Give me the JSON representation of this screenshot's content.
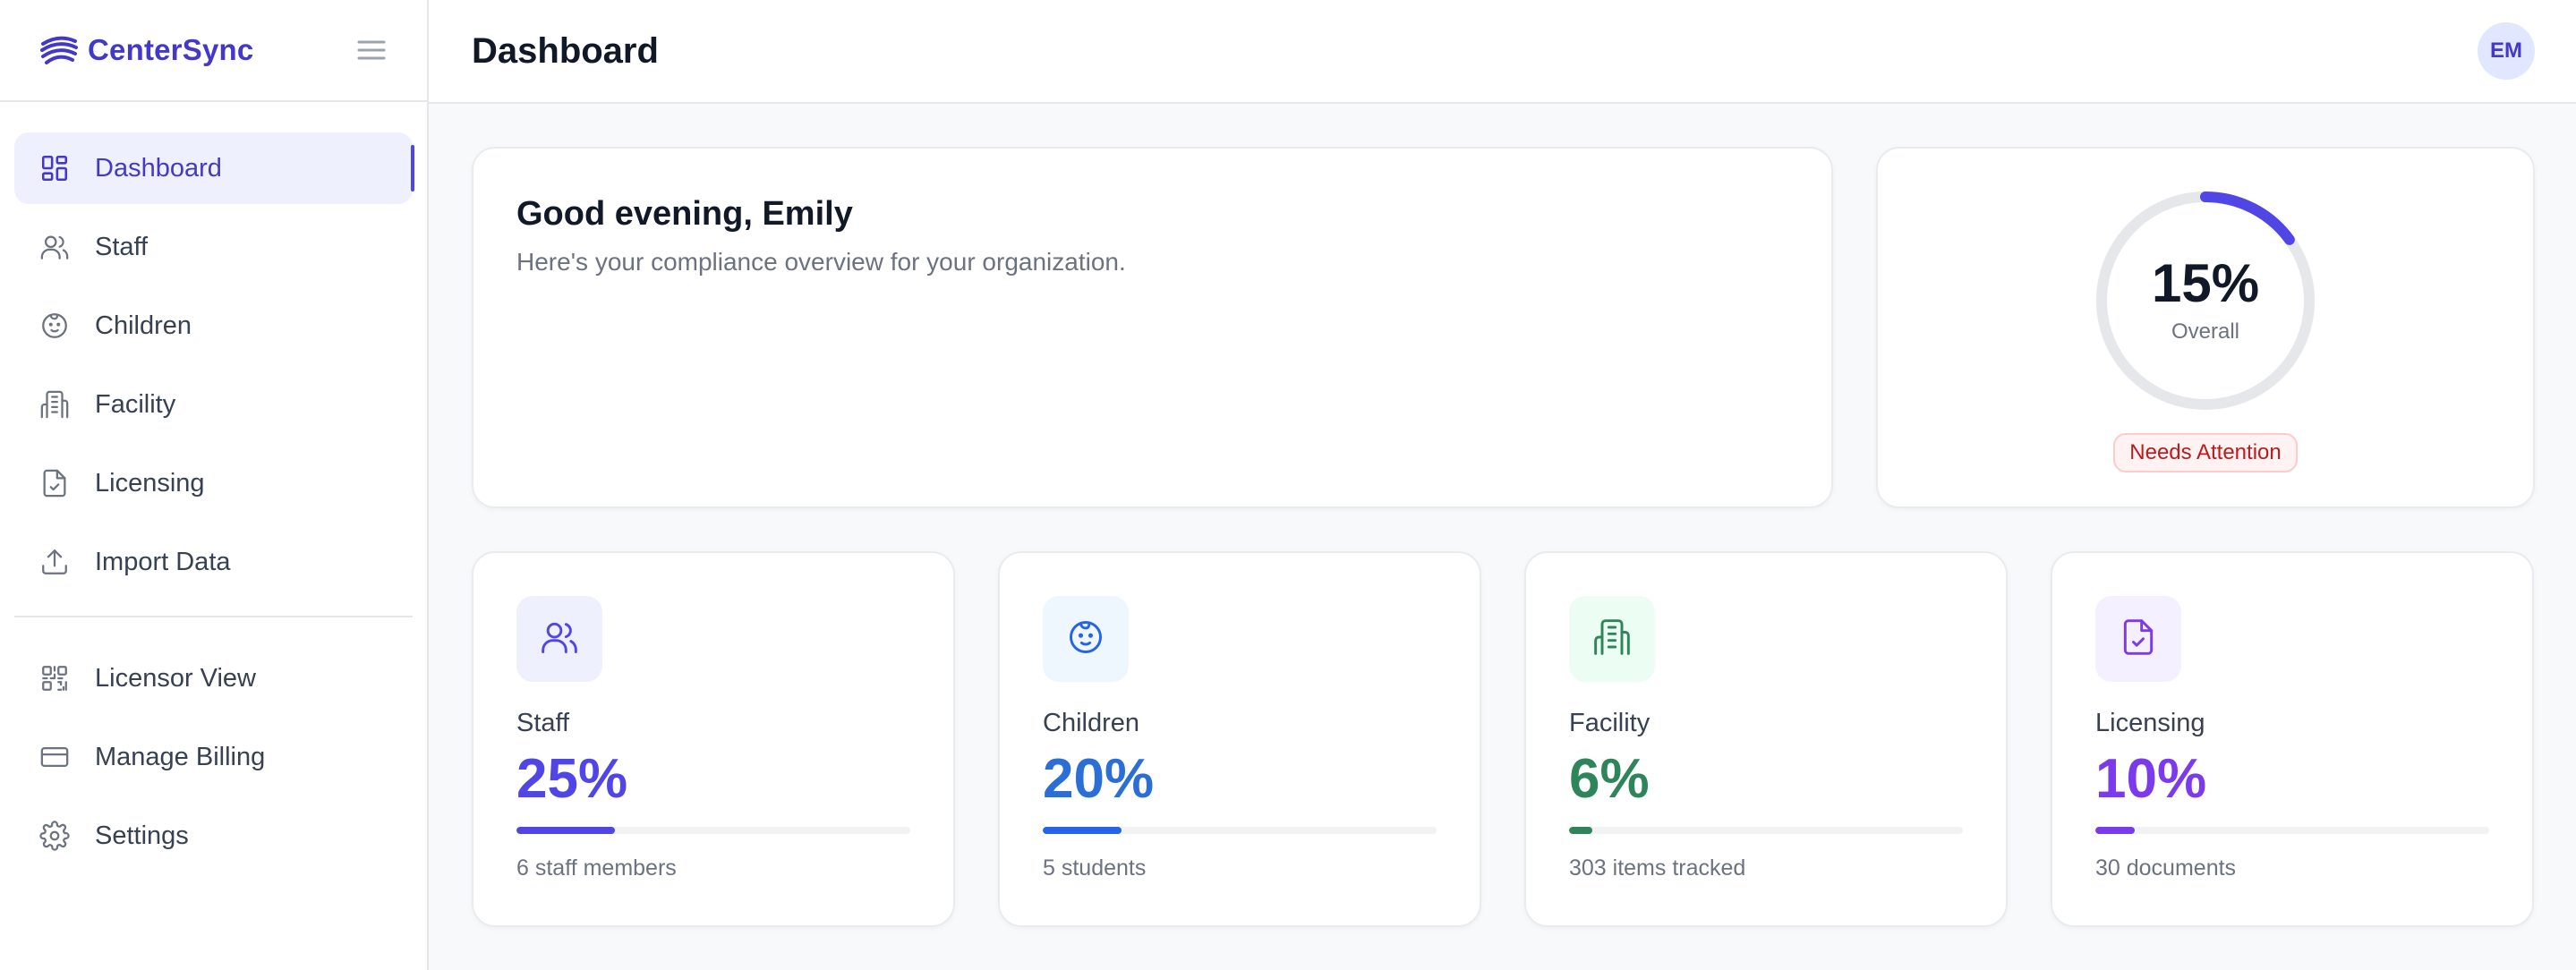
{
  "app": {
    "name": "CenterSync"
  },
  "header": {
    "title": "Dashboard",
    "avatar_initials": "EM"
  },
  "sidebar": {
    "items": [
      {
        "label": "Dashboard",
        "icon": "dashboard-grid-icon",
        "active": true
      },
      {
        "label": "Staff",
        "icon": "users-icon"
      },
      {
        "label": "Children",
        "icon": "baby-face-icon"
      },
      {
        "label": "Facility",
        "icon": "building-icon"
      },
      {
        "label": "Licensing",
        "icon": "file-check-icon"
      },
      {
        "label": "Import Data",
        "icon": "upload-icon"
      }
    ],
    "secondary_items": [
      {
        "label": "Licensor View",
        "icon": "qr-code-icon"
      },
      {
        "label": "Manage Billing",
        "icon": "credit-card-icon"
      },
      {
        "label": "Settings",
        "icon": "gear-icon"
      }
    ]
  },
  "welcome": {
    "greeting": "Good evening, Emily",
    "subtitle": "Here's your compliance overview for your organization."
  },
  "overall": {
    "value_text": "15%",
    "value": 0.15,
    "label": "Overall",
    "status": "Needs Attention",
    "ring_color": "#4f46e5"
  },
  "stats": [
    {
      "name": "Staff",
      "value_text": "25%",
      "value": 0.25,
      "sub": "6 staff members",
      "color": "#4f46e5",
      "icon_bg": "#eef0fd",
      "icon": "users-icon"
    },
    {
      "name": "Children",
      "value_text": "20%",
      "value": 0.2,
      "sub": "5 students",
      "color": "#2563eb",
      "icon_bg": "#eef6fe",
      "icon": "baby-face-icon"
    },
    {
      "name": "Facility",
      "value_text": "6%",
      "value": 0.06,
      "sub": "303 items tracked",
      "color": "#2f855a",
      "icon_bg": "#ecfdf3",
      "icon": "building-icon"
    },
    {
      "name": "Licensing",
      "value_text": "10%",
      "value": 0.1,
      "sub": "30 documents",
      "color": "#7c3aed",
      "icon_bg": "#f5f0ff",
      "icon": "file-check-icon"
    }
  ]
}
